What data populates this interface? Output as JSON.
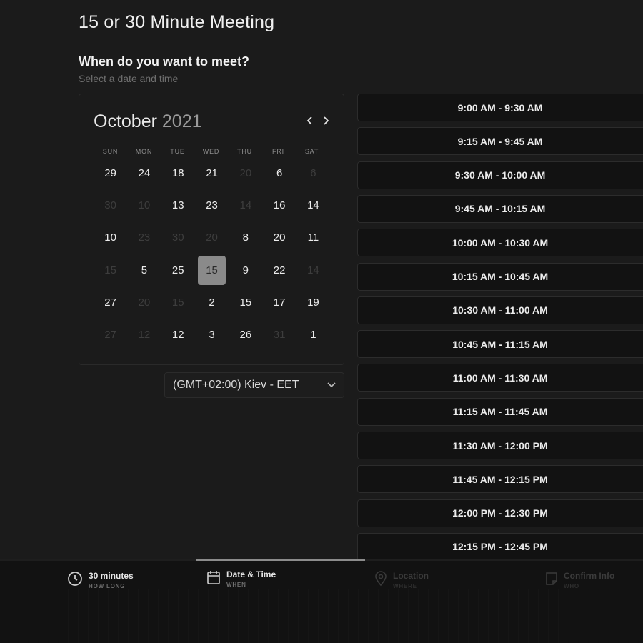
{
  "title": "15 or 30 Minute Meeting",
  "question": "When do you want to meet?",
  "subtitle": "Select a date and time",
  "calendar": {
    "month": "October",
    "year": "2021",
    "days_of_week": [
      "SUN",
      "MON",
      "TUE",
      "WED",
      "THU",
      "FRI",
      "SAT"
    ],
    "rows": [
      [
        {
          "d": "29"
        },
        {
          "d": "24"
        },
        {
          "d": "18"
        },
        {
          "d": "21"
        },
        {
          "d": "20",
          "dim": true
        },
        {
          "d": "6"
        },
        {
          "d": "6",
          "dim": true
        }
      ],
      [
        {
          "d": "30",
          "dim": true
        },
        {
          "d": "10",
          "dim": true
        },
        {
          "d": "13"
        },
        {
          "d": "23"
        },
        {
          "d": "14",
          "dim": true
        },
        {
          "d": "16"
        },
        {
          "d": "14"
        }
      ],
      [
        {
          "d": "10"
        },
        {
          "d": "23",
          "dim": true
        },
        {
          "d": "30",
          "dim": true
        },
        {
          "d": "20",
          "dim": true
        },
        {
          "d": "8"
        },
        {
          "d": "20"
        },
        {
          "d": "11"
        }
      ],
      [
        {
          "d": "15",
          "dim": true
        },
        {
          "d": "5"
        },
        {
          "d": "25"
        },
        {
          "d": "15",
          "selected": true
        },
        {
          "d": "9"
        },
        {
          "d": "22"
        },
        {
          "d": "14",
          "dim": true
        }
      ],
      [
        {
          "d": "27"
        },
        {
          "d": "20",
          "dim": true
        },
        {
          "d": "15",
          "dim": true
        },
        {
          "d": "2"
        },
        {
          "d": "15"
        },
        {
          "d": "17"
        },
        {
          "d": "19"
        }
      ],
      [
        {
          "d": "27",
          "dim": true
        },
        {
          "d": "12",
          "dim": true
        },
        {
          "d": "12"
        },
        {
          "d": "3"
        },
        {
          "d": "26"
        },
        {
          "d": "31",
          "dim": true
        },
        {
          "d": "1"
        }
      ]
    ]
  },
  "timezone": "(GMT+02:00) Kiev - EET",
  "time_slots": [
    "9:00 AM - 9:30 AM",
    "9:15 AM - 9:45 AM",
    "9:30 AM - 10:00 AM",
    "9:45 AM - 10:15 AM",
    "10:00 AM - 10:30 AM",
    "10:15 AM - 10:45 AM",
    "10:30 AM - 11:00 AM",
    "10:45 AM - 11:15 AM",
    "11:00 AM - 11:30 AM",
    "11:15 AM - 11:45 AM",
    "11:30 AM - 12:00 PM",
    "11:45 AM - 12:15 PM",
    "12:00 PM - 12:30 PM",
    "12:15 PM - 12:45 PM"
  ],
  "steps": [
    {
      "label": "30 minutes",
      "sub": "HOW LONG",
      "icon": "clock-icon",
      "active": true
    },
    {
      "label": "Date & Time",
      "sub": "WHEN",
      "icon": "calendar-icon",
      "active": true
    },
    {
      "label": "Location",
      "sub": "WHERE",
      "icon": "location-pin-icon",
      "active": false
    },
    {
      "label": "Confirm Info",
      "sub": "WHO",
      "icon": "note-icon",
      "active": false
    }
  ],
  "colors": {
    "background": "#1b1b1b",
    "selected_day": "#8a8a8a",
    "slot_background": "#121212",
    "footer": "#121212"
  }
}
